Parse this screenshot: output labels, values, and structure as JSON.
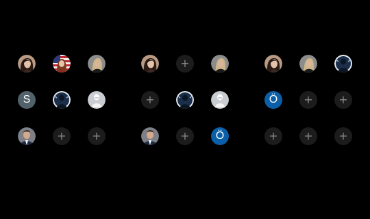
{
  "colors": {
    "background": "#000000",
    "empty_slot": "#1c1c1c",
    "plus_glyph": "#8a8a8a",
    "initial_s_bg": "#52626b",
    "initial_o_bg": "#0a5fa8"
  },
  "grids": [
    {
      "slots": [
        {
          "type": "photo",
          "icon": "woman-dark-hair-avatar-icon"
        },
        {
          "type": "photo",
          "icon": "flag-portrait-avatar-icon"
        },
        {
          "type": "photo",
          "icon": "blonde-woman-avatar-icon"
        },
        {
          "type": "initial",
          "text": "S"
        },
        {
          "type": "photo",
          "icon": "silhouette-blue-avatar-icon"
        },
        {
          "type": "photo",
          "icon": "white-figure-avatar-icon"
        },
        {
          "type": "photo",
          "icon": "man-suit-avatar-icon"
        },
        {
          "type": "add",
          "text": "+"
        },
        {
          "type": "add",
          "text": "+"
        }
      ]
    },
    {
      "slots": [
        {
          "type": "photo",
          "icon": "woman-dark-hair-avatar-icon"
        },
        {
          "type": "add",
          "text": "+"
        },
        {
          "type": "photo",
          "icon": "blonde-woman-avatar-icon"
        },
        {
          "type": "add",
          "text": "+"
        },
        {
          "type": "photo",
          "icon": "silhouette-blue-avatar-icon"
        },
        {
          "type": "photo",
          "icon": "white-figure-avatar-icon"
        },
        {
          "type": "photo",
          "icon": "man-suit-avatar-icon"
        },
        {
          "type": "add",
          "text": "+"
        },
        {
          "type": "initial",
          "text": "Ö"
        }
      ]
    },
    {
      "slots": [
        {
          "type": "photo",
          "icon": "woman-dark-hair-avatar-icon"
        },
        {
          "type": "photo",
          "icon": "blonde-woman-avatar-icon"
        },
        {
          "type": "photo",
          "icon": "silhouette-blue-avatar-icon"
        },
        {
          "type": "initial",
          "text": "Ö"
        },
        {
          "type": "add",
          "text": "+"
        },
        {
          "type": "add",
          "text": "+"
        },
        {
          "type": "add",
          "text": "+"
        },
        {
          "type": "add",
          "text": "+"
        },
        {
          "type": "add",
          "text": "+"
        }
      ]
    }
  ]
}
